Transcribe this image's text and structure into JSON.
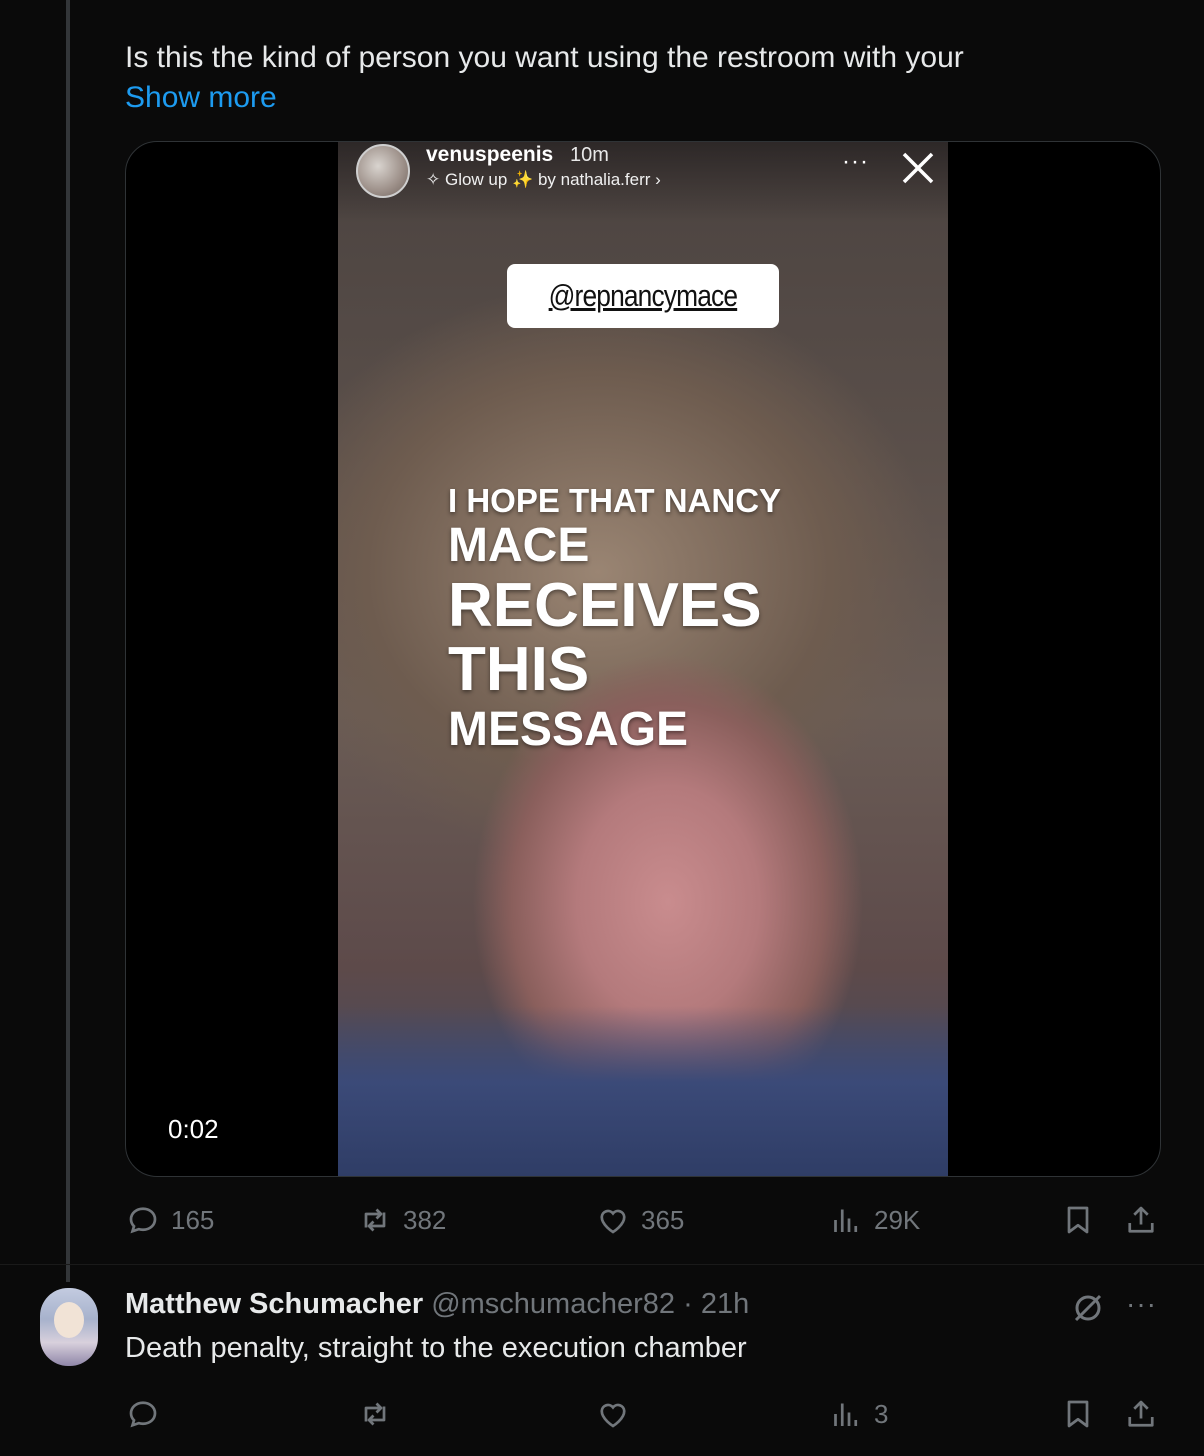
{
  "tweet": {
    "text": "Is this the kind of person you want using the restroom with your",
    "show_more_label": "Show more",
    "video": {
      "story_username": "venuspeenis",
      "story_time": "10m",
      "story_subtitle": "✧ Glow up ✨ by nathalia.ferr ›",
      "mention_tag": "@repnancymace",
      "overlay_lines": [
        "I HOPE THAT NANCY",
        "MACE",
        "RECEIVES",
        "THIS",
        "MESSAGE"
      ],
      "timestamp": "0:02"
    },
    "actions": {
      "replies": "165",
      "reposts": "382",
      "likes": "365",
      "views": "29K"
    }
  },
  "reply": {
    "name": "Matthew Schumacher",
    "handle": "@mschumacher82",
    "separator": "·",
    "time": "21h",
    "text": "Death penalty, straight to the execution chamber",
    "actions": {
      "replies": "",
      "reposts": "",
      "likes": "",
      "views": "3"
    }
  },
  "colors": {
    "background": "#0a0a0a",
    "text": "#e7e9ea",
    "muted": "#71767b",
    "link": "#1d9bf0",
    "border": "#2f3336"
  },
  "icons": [
    "reply-icon",
    "repost-icon",
    "like-icon",
    "views-icon",
    "bookmark-icon",
    "share-icon",
    "close-icon",
    "more-icon",
    "grok-icon"
  ]
}
